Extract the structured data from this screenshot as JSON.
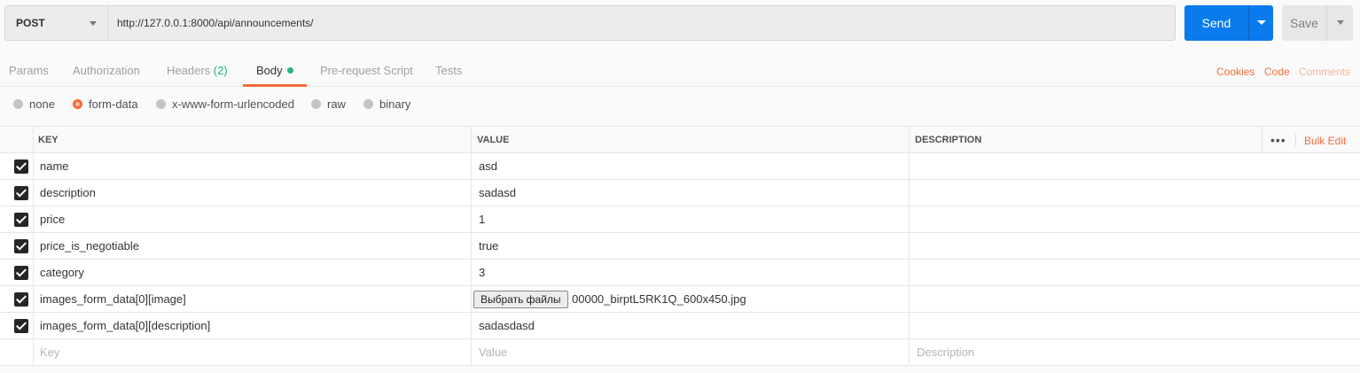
{
  "request": {
    "method": "POST",
    "url": "http://127.0.0.1:8000/api/announcements/",
    "send_label": "Send",
    "save_label": "Save"
  },
  "tabs": [
    {
      "label": "Params"
    },
    {
      "label": "Authorization"
    },
    {
      "label": "Headers",
      "count": "(2)"
    },
    {
      "label": "Body"
    },
    {
      "label": "Pre-request Script"
    },
    {
      "label": "Tests"
    }
  ],
  "right_links": {
    "cookies": "Cookies",
    "code": "Code",
    "comments": "Comments"
  },
  "body_modes": [
    {
      "label": "none",
      "selected": false
    },
    {
      "label": "form-data",
      "selected": true
    },
    {
      "label": "x-www-form-urlencoded",
      "selected": false
    },
    {
      "label": "raw",
      "selected": false
    },
    {
      "label": "binary",
      "selected": false
    }
  ],
  "table": {
    "headers": {
      "key": "KEY",
      "value": "VALUE",
      "description": "DESCRIPTION"
    },
    "more": "•••",
    "bulk_edit": "Bulk Edit",
    "rows": [
      {
        "key": "name",
        "value": "asd"
      },
      {
        "key": "description",
        "value": "sadasd"
      },
      {
        "key": "price",
        "value": "1"
      },
      {
        "key": "price_is_negotiable",
        "value": "true"
      },
      {
        "key": "category",
        "value": "3"
      },
      {
        "key": "images_form_data[0][image]",
        "file_button": "Выбрать файлы",
        "file_name": "00000_birptL5RK1Q_600x450.jpg"
      },
      {
        "key": "images_form_data[0][description]",
        "value": "sadasdasd"
      }
    ],
    "placeholders": {
      "key": "Key",
      "value": "Value",
      "description": "Description"
    }
  },
  "colors": {
    "accent": "#f26b3a",
    "send": "#097bed",
    "active_dot": "#26b47f"
  }
}
